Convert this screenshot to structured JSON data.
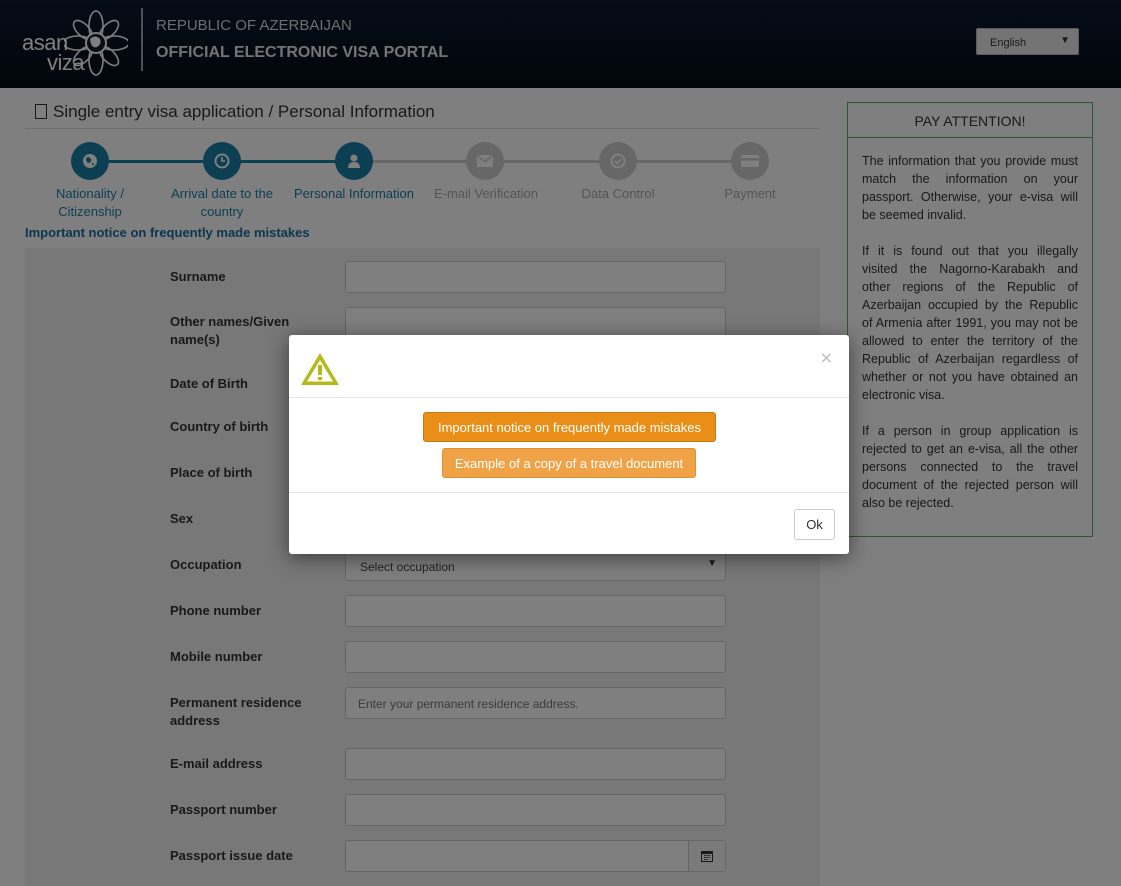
{
  "header": {
    "logo_top": "asan",
    "logo_bottom": "viza",
    "country": "REPUBLIC OF AZERBAIJAN",
    "portal": "OFFICIAL ELECTRONIC VISA PORTAL",
    "language": "English"
  },
  "page": {
    "title": "Single entry visa application / Personal Information",
    "notice_link": "Important notice on frequently made mistakes"
  },
  "steps": [
    {
      "label": "Nationality / Citizenship",
      "icon": "globe-icon",
      "state": "done"
    },
    {
      "label": "Arrival date to the country",
      "icon": "clock-icon",
      "state": "done"
    },
    {
      "label": "Personal Information",
      "icon": "user-icon",
      "state": "done"
    },
    {
      "label": "E-mail Verification",
      "icon": "envelope-icon",
      "state": "todo"
    },
    {
      "label": "Data Control",
      "icon": "check-icon",
      "state": "todo"
    },
    {
      "label": "Payment",
      "icon": "credit-card-icon",
      "state": "todo"
    }
  ],
  "form": {
    "surname": {
      "label": "Surname",
      "value": ""
    },
    "other_names": {
      "label": "Other names/Given name(s)",
      "value": ""
    },
    "dob": {
      "label": "Date of Birth"
    },
    "country_of_birth": {
      "label": "Country of birth"
    },
    "place_of_birth": {
      "label": "Place of birth",
      "value": ""
    },
    "sex": {
      "label": "Sex"
    },
    "occupation": {
      "label": "Occupation",
      "value": "Select occupation"
    },
    "phone": {
      "label": "Phone number",
      "value": ""
    },
    "mobile": {
      "label": "Mobile number",
      "value": ""
    },
    "residence": {
      "label": "Permanent residence address",
      "placeholder": "Enter your permanent residence address."
    },
    "email": {
      "label": "E-mail address",
      "value": ""
    },
    "passport_number": {
      "label": "Passport number",
      "value": ""
    },
    "passport_issue_date": {
      "label": "Passport issue date",
      "value": ""
    }
  },
  "attention": {
    "title": "PAY ATTENTION!",
    "p1": "The information that you provide must match the information on your passport. Otherwise, your e-visa will be seemed invalid.",
    "p2": "If it is found out that you illegally visited the Nagorno-Karabakh and other regions of the Republic of Azerbaijan occupied by the Republic of Armenia after 1991, you may not be allowed to enter the territory of the Republic of Azerbaijan regardless of whether or not you have obtained an electronic visa.",
    "p3": "If a person in group application is rejected to get an e-visa, all the other persons connected to the travel document of the rejected person will also be rejected."
  },
  "modal": {
    "btn_notice": "Important notice on frequently made mistakes",
    "btn_example": "Example of a copy of a travel document",
    "ok": "Ok",
    "close": "×"
  },
  "colors": {
    "primary_blue": "#1a7ea6",
    "orange": "#e98f17",
    "attention_border": "#5bb05b"
  }
}
